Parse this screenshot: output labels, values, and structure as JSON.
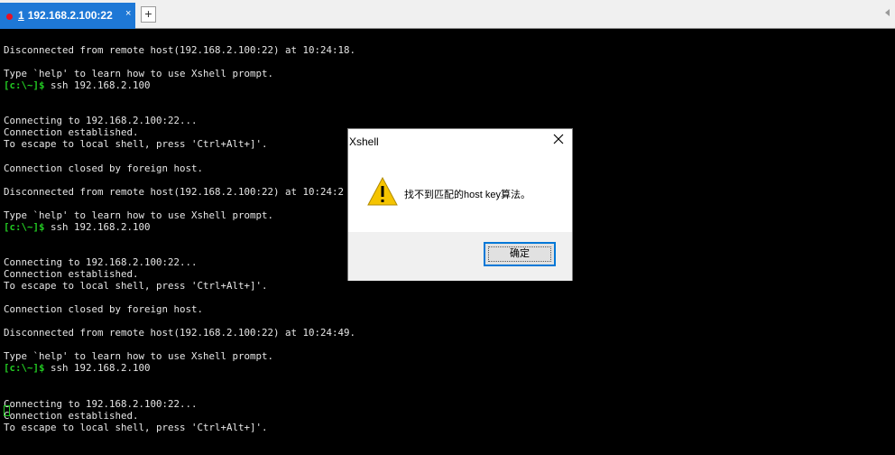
{
  "tab": {
    "number": "1",
    "title": "192.168.2.100:22",
    "close_glyph": "×",
    "new_tab_glyph": "+"
  },
  "terminal": {
    "lines": [
      {
        "text": "Disconnected from remote host(192.168.2.100:22) at 10:24:18."
      },
      {
        "text": ""
      },
      {
        "text": "Type `help' to learn how to use Xshell prompt."
      },
      {
        "prompt": "[c:\\~]$",
        "text": " ssh 192.168.2.100"
      },
      {
        "text": ""
      },
      {
        "text": ""
      },
      {
        "text": "Connecting to 192.168.2.100:22..."
      },
      {
        "text": "Connection established."
      },
      {
        "text": "To escape to local shell, press 'Ctrl+Alt+]'."
      },
      {
        "text": ""
      },
      {
        "text": "Connection closed by foreign host."
      },
      {
        "text": ""
      },
      {
        "text": "Disconnected from remote host(192.168.2.100:22) at 10:24:2"
      },
      {
        "text": ""
      },
      {
        "text": "Type `help' to learn how to use Xshell prompt."
      },
      {
        "prompt": "[c:\\~]$",
        "text": " ssh 192.168.2.100"
      },
      {
        "text": ""
      },
      {
        "text": ""
      },
      {
        "text": "Connecting to 192.168.2.100:22..."
      },
      {
        "text": "Connection established."
      },
      {
        "text": "To escape to local shell, press 'Ctrl+Alt+]'."
      },
      {
        "text": ""
      },
      {
        "text": "Connection closed by foreign host."
      },
      {
        "text": ""
      },
      {
        "text": "Disconnected from remote host(192.168.2.100:22) at 10:24:49."
      },
      {
        "text": ""
      },
      {
        "text": "Type `help' to learn how to use Xshell prompt."
      },
      {
        "prompt": "[c:\\~]$",
        "text": " ssh 192.168.2.100"
      },
      {
        "text": ""
      },
      {
        "text": ""
      },
      {
        "text": "Connecting to 192.168.2.100:22..."
      },
      {
        "text": "Connection established."
      },
      {
        "text": "To escape to local shell, press 'Ctrl+Alt+]'."
      }
    ]
  },
  "dialog": {
    "title": "Xshell",
    "icon": "warning-icon",
    "message": "找不到匹配的host key算法。",
    "ok_label": "确定"
  },
  "colors": {
    "tab_active": "#1e78d6",
    "terminal_bg": "#000000",
    "terminal_fg": "#e6e6e6",
    "prompt": "#22c822",
    "warning": "#f5c400"
  }
}
